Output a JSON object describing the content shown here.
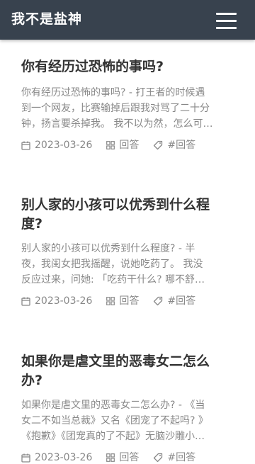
{
  "header": {
    "site_title": "我不是盐神",
    "menu_icon": "hamburger-menu-icon"
  },
  "posts": [
    {
      "title": "你有经历过恐怖的事吗?",
      "excerpt_lines": [
        "你有经历过恐怖的事吗? - 打王者的时候遇",
        "到一个网友，比赛输掉后跟我对骂了二十分",
        "钟，扬言要杀掉我。 我不以为然，怎么可…"
      ],
      "date": "2023-03-26",
      "category": "回答",
      "tag": "#回答"
    },
    {
      "title": "别人家的小孩可以优秀到什么程度?",
      "title_lines": [
        "别人家的小孩可以优秀到什么程",
        "度?"
      ],
      "excerpt_lines": [
        "别人家的小孩可以优秀到什么程度? - 半",
        "夜，我闺女把我摇醒，说她吃药了。 我没",
        "反应过来，问她: 「吃药干什么? 哪不舒…"
      ],
      "date": "2023-03-26",
      "category": "回答",
      "tag": "#回答"
    },
    {
      "title": "如果你是虐文里的恶毒女二怎么办?",
      "title_lines": [
        "如果你是虐文里的恶毒女二怎么",
        "办?"
      ],
      "excerpt_lines": [
        "如果你是虐文里的恶毒女二怎么办? - 《当",
        "女二不如当总裁》又名《团宠了不起吗? 》",
        "《抱歉》《团宠真的了不起》无脑沙雕小…"
      ],
      "date": "2023-03-26",
      "category": "回答",
      "tag": "#回答"
    }
  ],
  "icons": {
    "date": "calendar-icon",
    "category": "grid-icon",
    "tag": "tag-icon"
  }
}
